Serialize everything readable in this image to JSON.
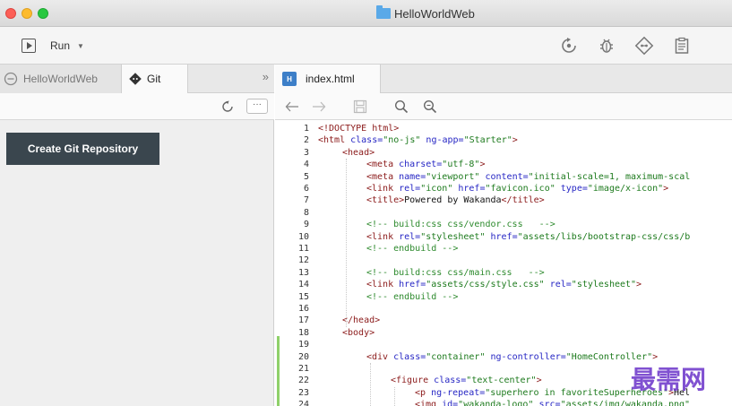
{
  "window": {
    "title": "HelloWorldWeb"
  },
  "toolbar": {
    "run_label": "Run",
    "run_caret": "▼",
    "icons": [
      "restart-icon",
      "debug-bug-icon",
      "git-diamond-icon",
      "clipboard-icon"
    ]
  },
  "left_panel": {
    "tabs": [
      {
        "label": "HelloWorldWeb"
      },
      {
        "label": "Git"
      }
    ],
    "more_chevron": "»",
    "more_button": "···",
    "create_button_label": "Create Git Repository"
  },
  "editor": {
    "tab": {
      "badge": "H",
      "label": "index.html"
    },
    "lines": [
      {
        "n": "1",
        "indent": 0,
        "parts": [
          [
            "tag",
            "<!DOCTYPE html>"
          ]
        ]
      },
      {
        "n": "2",
        "indent": 0,
        "parts": [
          [
            "tag",
            "<html "
          ],
          [
            "attr",
            "class="
          ],
          [
            "val",
            "\"no-js\""
          ],
          [
            "attr",
            " ng-app="
          ],
          [
            "val",
            "\"Starter\""
          ],
          [
            "tag",
            ">"
          ]
        ]
      },
      {
        "n": "3",
        "indent": 1,
        "parts": [
          [
            "tag",
            "<head>"
          ]
        ]
      },
      {
        "n": "4",
        "indent": 2,
        "parts": [
          [
            "tag",
            "<meta "
          ],
          [
            "attr",
            "charset="
          ],
          [
            "val",
            "\"utf-8\""
          ],
          [
            "tag",
            ">"
          ]
        ]
      },
      {
        "n": "5",
        "indent": 2,
        "parts": [
          [
            "tag",
            "<meta "
          ],
          [
            "attr",
            "name="
          ],
          [
            "val",
            "\"viewport\""
          ],
          [
            "attr",
            " content="
          ],
          [
            "val",
            "\"initial-scale=1, maximum-scal"
          ]
        ]
      },
      {
        "n": "6",
        "indent": 2,
        "parts": [
          [
            "tag",
            "<link "
          ],
          [
            "attr",
            "rel="
          ],
          [
            "val",
            "\"icon\""
          ],
          [
            "attr",
            " href="
          ],
          [
            "val",
            "\"favicon.ico\""
          ],
          [
            "attr",
            " type="
          ],
          [
            "val",
            "\"image/x-icon\""
          ],
          [
            "tag",
            ">"
          ]
        ]
      },
      {
        "n": "7",
        "indent": 2,
        "parts": [
          [
            "tag",
            "<title>"
          ],
          [
            "txt",
            "Powered by Wakanda"
          ],
          [
            "tag",
            "</title>"
          ]
        ]
      },
      {
        "n": "8",
        "indent": 0,
        "parts": []
      },
      {
        "n": "9",
        "indent": 2,
        "parts": [
          [
            "com",
            "<!-- build:css css/vendor.css   -->"
          ]
        ]
      },
      {
        "n": "10",
        "indent": 2,
        "parts": [
          [
            "tag",
            "<link "
          ],
          [
            "attr",
            "rel="
          ],
          [
            "val",
            "\"stylesheet\""
          ],
          [
            "attr",
            " href="
          ],
          [
            "val",
            "\"assets/libs/bootstrap-css/css/b"
          ]
        ]
      },
      {
        "n": "11",
        "indent": 2,
        "parts": [
          [
            "com",
            "<!-- endbuild -->"
          ]
        ]
      },
      {
        "n": "12",
        "indent": 0,
        "parts": []
      },
      {
        "n": "13",
        "indent": 2,
        "parts": [
          [
            "com",
            "<!-- build:css css/main.css   -->"
          ]
        ]
      },
      {
        "n": "14",
        "indent": 2,
        "parts": [
          [
            "tag",
            "<link "
          ],
          [
            "attr",
            "href="
          ],
          [
            "val",
            "\"assets/css/style.css\""
          ],
          [
            "attr",
            " rel="
          ],
          [
            "val",
            "\"stylesheet\""
          ],
          [
            "tag",
            ">"
          ]
        ]
      },
      {
        "n": "15",
        "indent": 2,
        "parts": [
          [
            "com",
            "<!-- endbuild -->"
          ]
        ]
      },
      {
        "n": "16",
        "indent": 0,
        "parts": []
      },
      {
        "n": "17",
        "indent": 1,
        "parts": [
          [
            "tag",
            "</head>"
          ]
        ]
      },
      {
        "n": "18",
        "indent": 1,
        "parts": [
          [
            "tag",
            "<body>"
          ]
        ]
      },
      {
        "n": "19",
        "indent": 0,
        "parts": []
      },
      {
        "n": "20",
        "indent": 2,
        "parts": [
          [
            "tag",
            "<div "
          ],
          [
            "attr",
            "class="
          ],
          [
            "val",
            "\"container\""
          ],
          [
            "attr",
            " ng-controller="
          ],
          [
            "val",
            "\"HomeController\""
          ],
          [
            "tag",
            ">"
          ]
        ]
      },
      {
        "n": "21",
        "indent": 0,
        "parts": []
      },
      {
        "n": "22",
        "indent": 3,
        "parts": [
          [
            "tag",
            "<figure "
          ],
          [
            "attr",
            "class="
          ],
          [
            "val",
            "\"text-center\""
          ],
          [
            "tag",
            ">"
          ]
        ]
      },
      {
        "n": "23",
        "indent": 4,
        "parts": [
          [
            "tag",
            "<p "
          ],
          [
            "attr",
            "ng-repeat="
          ],
          [
            "val",
            "\"superhero in favoriteSuperheroes\""
          ],
          [
            "tag",
            ">"
          ],
          [
            "txt",
            "Hel"
          ]
        ]
      },
      {
        "n": "24",
        "indent": 4,
        "parts": [
          [
            "tag",
            "<img "
          ],
          [
            "attr",
            "id="
          ],
          [
            "val",
            "\"wakanda-logo\""
          ],
          [
            "attr",
            " src="
          ],
          [
            "val",
            "\"assets/img/wakanda.png\""
          ]
        ]
      }
    ]
  },
  "watermark": "最需网"
}
